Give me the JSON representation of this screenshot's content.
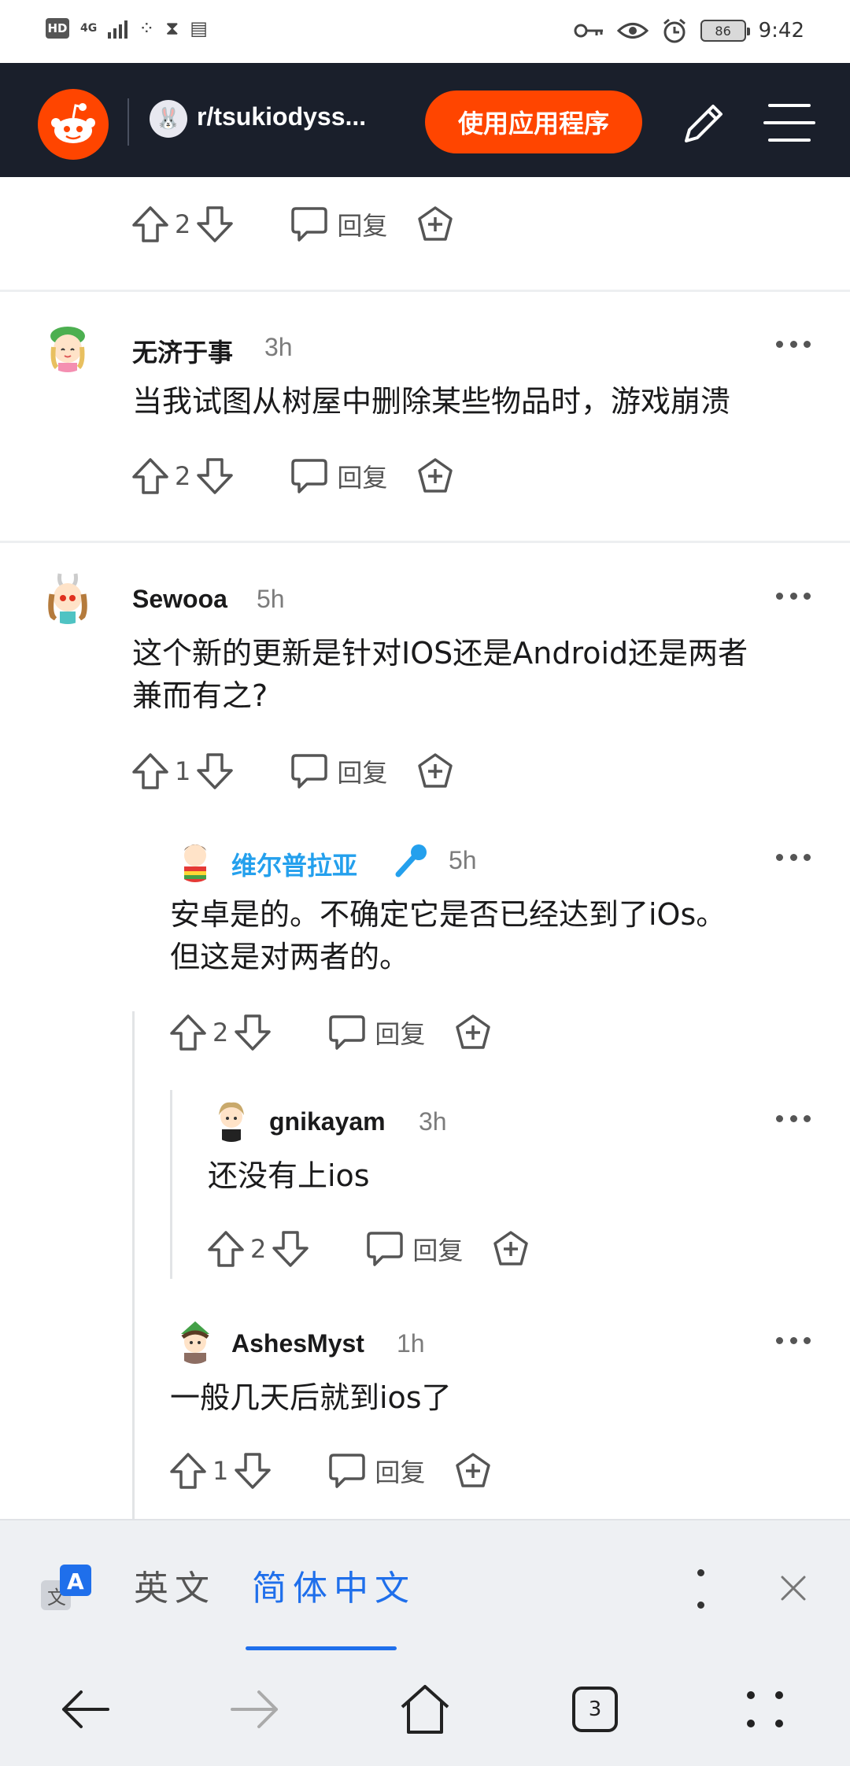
{
  "status_bar": {
    "hd": "HD",
    "network": "4G",
    "battery": "86",
    "time": "9:42"
  },
  "header": {
    "subreddit": "r/tsukiodyss...",
    "open_app_label": "使用应用程序",
    "brand_color": "#ff4500"
  },
  "comments": [
    {
      "partial": true,
      "upvotes": "2",
      "reply_label": "回复"
    },
    {
      "username": "无济于事",
      "time": "3h",
      "text": "当我试图从树屋中删除某些物品时，游戏崩溃",
      "upvotes": "2",
      "reply_label": "回复"
    },
    {
      "username": "Sewooa",
      "time": "5h",
      "text_line1": "这个新的更新是针对IOS还是Android还是两者",
      "text_line2": "兼而有之?",
      "upvotes": "1",
      "reply_label": "回复"
    },
    {
      "username": "维尔普拉亚",
      "flair_icon": "microphone-icon",
      "time": "5h",
      "text_line1": "安卓是的。不确定它是否已经达到了iOs。",
      "text_line2": "但这是对两者的。",
      "upvotes": "2",
      "reply_label": "回复"
    },
    {
      "username": "gnikayam",
      "time": "3h",
      "text": "还没有上ios",
      "upvotes": "2",
      "reply_label": "回复"
    },
    {
      "username": "AshesMyst",
      "time": "1h",
      "text": "一般几天后就到ios了",
      "upvotes": "1",
      "reply_label": "回复"
    }
  ],
  "translate_bar": {
    "source_lang": "英文",
    "target_lang": "简体中文",
    "active_color": "#1f6feb"
  },
  "nav_bar": {
    "tab_count": "3"
  }
}
